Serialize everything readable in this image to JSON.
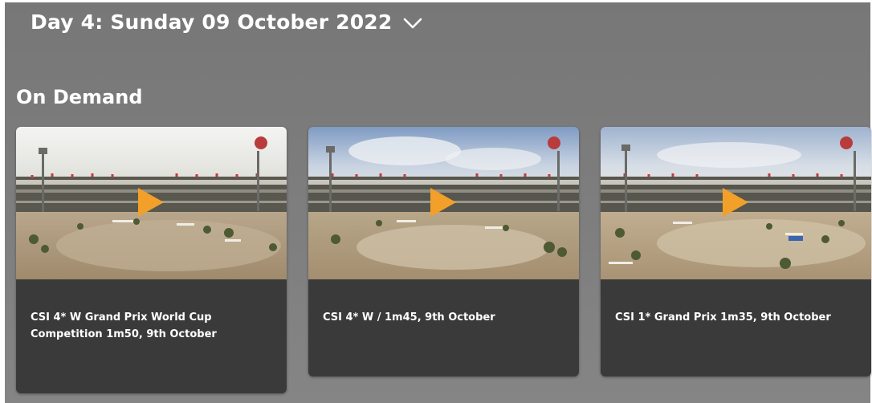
{
  "header": {
    "day_label": "Day 4: Sunday 09 October 2022",
    "dropdown_icon": "chevron-down-icon"
  },
  "section": {
    "title": "On Demand"
  },
  "videos": [
    {
      "title": "CSI 4* W Grand Prix World Cup Competition 1m50, 9th October",
      "play_icon": "play-icon"
    },
    {
      "title": "CSI 4* W / 1m45, 9th October",
      "play_icon": "play-icon"
    },
    {
      "title": "CSI 1* Grand Prix 1m35, 9th October",
      "play_icon": "play-icon"
    }
  ],
  "colors": {
    "background": "#7c7c7c",
    "card_background": "#3a3a3a",
    "play_accent": "#f2a02a",
    "text": "#ffffff"
  }
}
